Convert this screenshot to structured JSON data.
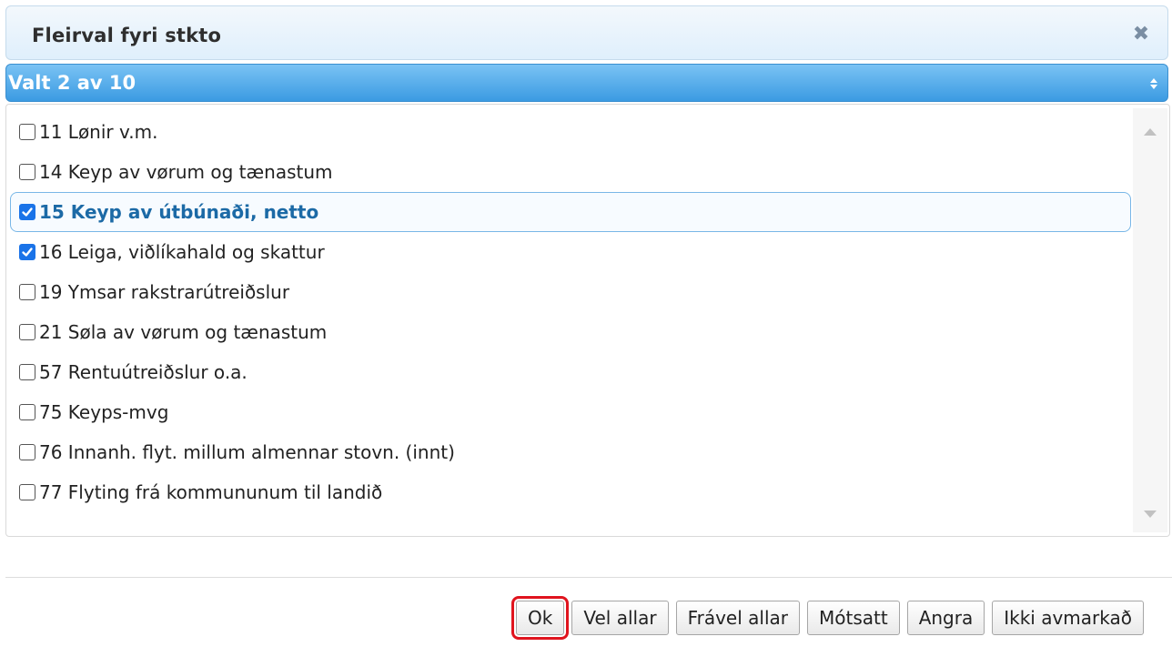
{
  "dialog": {
    "title": "Fleirval fyri stkto",
    "close_icon": "close-icon"
  },
  "selection_header": {
    "label": "Valt 2 av 10",
    "icon": "updown-caret-icon"
  },
  "items": [
    {
      "label": "11 Lønir v.m.",
      "checked": false,
      "focused": false
    },
    {
      "label": "14 Keyp av vørum og tænastum",
      "checked": false,
      "focused": false
    },
    {
      "label": "15 Keyp av útbúnaði, netto",
      "checked": true,
      "focused": true
    },
    {
      "label": "16 Leiga, viðlíkahald og skattur",
      "checked": true,
      "focused": false
    },
    {
      "label": "19 Ymsar rakstrarútreiðslur",
      "checked": false,
      "focused": false
    },
    {
      "label": "21 Søla av vørum og tænastum",
      "checked": false,
      "focused": false
    },
    {
      "label": "57 Rentuútreiðslur o.a.",
      "checked": false,
      "focused": false
    },
    {
      "label": "75 Keyps-mvg",
      "checked": false,
      "focused": false
    },
    {
      "label": "76 Innanh. flyt. millum almennar stovn. (innt)",
      "checked": false,
      "focused": false
    },
    {
      "label": "77 Flyting frá kommununum til landið",
      "checked": false,
      "focused": false
    }
  ],
  "buttons": {
    "ok": "Ok",
    "select_all": "Vel allar",
    "deselect_all": "Frável allar",
    "invert": "Mótsatt",
    "undo": "Angra",
    "unrestricted": "Ikki avmarkað"
  },
  "colors": {
    "header_blue": "#3b9be2",
    "checkbox_blue": "#1a73e8",
    "focus_text": "#1c6aa6",
    "highlight_red": "#e0141e"
  }
}
